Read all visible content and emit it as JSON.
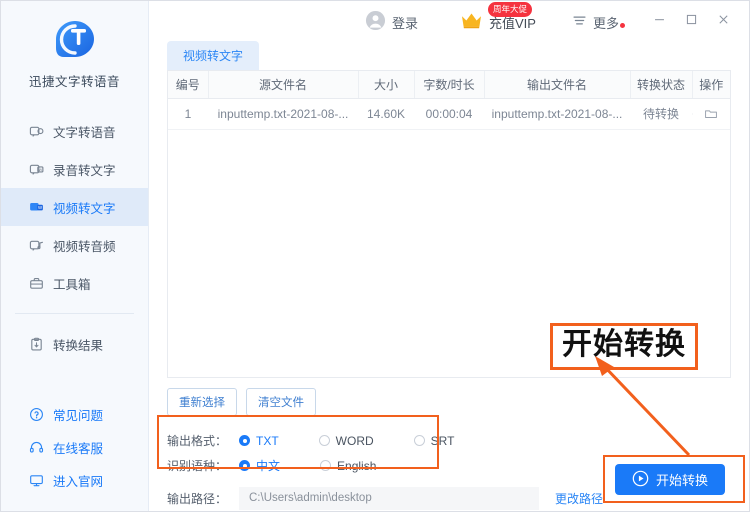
{
  "app": {
    "logo_text": "迅捷文字转语音",
    "logo_icon": "speech-bubble-t-icon"
  },
  "titlebar": {
    "login_label": "登录",
    "login_icon": "user-circle-icon",
    "vip_label": "充值VIP",
    "vip_icon": "crown-icon",
    "vip_badge": "周年大促",
    "more_label": "更多",
    "more_icon": "hamburger-icon",
    "minimize_icon": "minimize-icon",
    "maximize_icon": "maximize-icon",
    "close_icon": "close-icon"
  },
  "sidebar": {
    "items": [
      {
        "label": "文字转语音",
        "icon": "text-to-speech-icon",
        "active": false
      },
      {
        "label": "录音转文字",
        "icon": "audio-to-text-icon",
        "active": false
      },
      {
        "label": "视频转文字",
        "icon": "video-to-text-icon",
        "active": true
      },
      {
        "label": "视频转音频",
        "icon": "video-to-audio-icon",
        "active": false
      },
      {
        "label": "工具箱",
        "icon": "toolbox-icon",
        "active": false
      },
      {
        "label": "转换结果",
        "icon": "results-icon",
        "active": false
      }
    ],
    "links": [
      {
        "label": "常见问题",
        "icon": "question-circle-icon"
      },
      {
        "label": "在线客服",
        "icon": "headset-icon"
      },
      {
        "label": "进入官网",
        "icon": "monitor-icon"
      }
    ]
  },
  "main": {
    "tab_label": "视频转文字",
    "table": {
      "headers": [
        "编号",
        "源文件名",
        "大小",
        "字数/时长",
        "输出文件名",
        "转换状态",
        "操作"
      ],
      "rows": [
        {
          "index": "1",
          "source_name": "inputtemp.txt-2021-08-...",
          "size": "14.60K",
          "duration": "00:00:04",
          "output_name": "inputtemp.txt-2021-08-...",
          "status": "待转换",
          "ops": [
            "eye-icon",
            "folder-icon",
            "delete-circle-icon"
          ]
        }
      ]
    },
    "buttons": {
      "reselect": "重新选择",
      "clear": "清空文件"
    },
    "options": {
      "format_label": "输出格式：",
      "format_choices": [
        {
          "label": "TXT",
          "selected": true
        },
        {
          "label": "WORD",
          "selected": false
        },
        {
          "label": "SRT",
          "selected": false
        }
      ],
      "language_label": "识别语种：",
      "language_choices": [
        {
          "label": "中文",
          "selected": true
        },
        {
          "label": "English",
          "selected": false
        }
      ]
    },
    "path": {
      "label": "输出路径：",
      "value": "C:\\Users\\admin\\desktop",
      "change_link": "更改路径"
    },
    "start_button": {
      "label": "开始转换",
      "icon": "play-circle-icon"
    }
  },
  "annotations": {
    "callout_text": "开始转换",
    "accent_color": "#f2601d"
  }
}
